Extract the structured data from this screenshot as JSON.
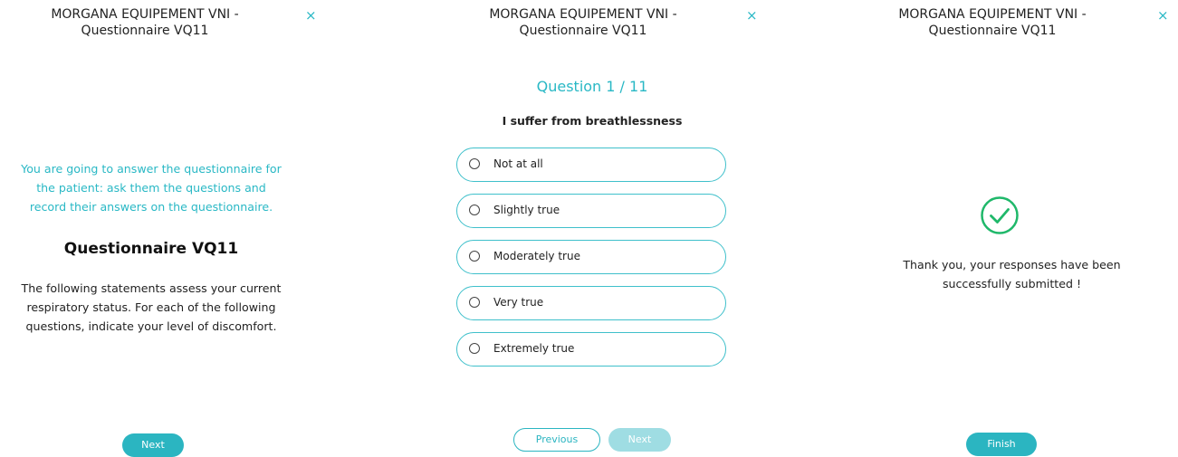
{
  "header": {
    "title_line1": "MORGANA EQUIPEMENT VNI -",
    "title_line2": "Questionnaire VQ11",
    "close_glyph": "×"
  },
  "intro_screen": {
    "instruction_line1": "You are going to answer the questionnaire for",
    "instruction_line2": "the patient: ask them the questions and",
    "instruction_line3": "record their answers on the questionnaire.",
    "heading": "Questionnaire VQ11",
    "description_line1": "The following statements assess your current",
    "description_line2": "respiratory status. For each of the following",
    "description_line3": "questions, indicate your level of discomfort.",
    "next_label": "Next"
  },
  "question_screen": {
    "counter": "Question 1 / 11",
    "question": "I suffer from breathlessness",
    "options": [
      {
        "label": "Not at all",
        "selected": false
      },
      {
        "label": "Slightly true",
        "selected": false
      },
      {
        "label": "Moderately true",
        "selected": false
      },
      {
        "label": "Very true",
        "selected": false
      },
      {
        "label": "Extremely true",
        "selected": false
      }
    ],
    "previous_label": "Previous",
    "next_label": "Next"
  },
  "done_screen": {
    "message_line1": "Thank you, your responses have been",
    "message_line2": "successfully submitted !",
    "finish_label": "Finish",
    "icon": "check-circle-icon"
  },
  "colors": {
    "accent": "#2bb5c1",
    "success": "#1fb86a"
  }
}
